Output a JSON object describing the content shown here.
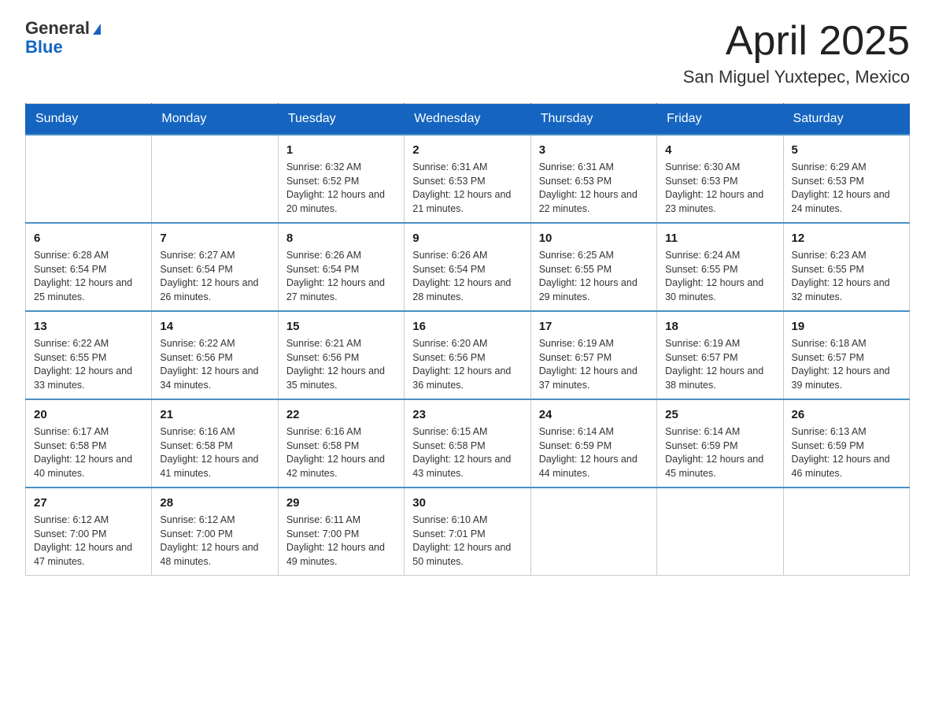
{
  "header": {
    "logo_general": "General",
    "logo_blue": "Blue",
    "month_title": "April 2025",
    "location": "San Miguel Yuxtepec, Mexico"
  },
  "weekdays": [
    "Sunday",
    "Monday",
    "Tuesday",
    "Wednesday",
    "Thursday",
    "Friday",
    "Saturday"
  ],
  "weeks": [
    [
      {
        "day": "",
        "sunrise": "",
        "sunset": "",
        "daylight": ""
      },
      {
        "day": "",
        "sunrise": "",
        "sunset": "",
        "daylight": ""
      },
      {
        "day": "1",
        "sunrise": "Sunrise: 6:32 AM",
        "sunset": "Sunset: 6:52 PM",
        "daylight": "Daylight: 12 hours and 20 minutes."
      },
      {
        "day": "2",
        "sunrise": "Sunrise: 6:31 AM",
        "sunset": "Sunset: 6:53 PM",
        "daylight": "Daylight: 12 hours and 21 minutes."
      },
      {
        "day": "3",
        "sunrise": "Sunrise: 6:31 AM",
        "sunset": "Sunset: 6:53 PM",
        "daylight": "Daylight: 12 hours and 22 minutes."
      },
      {
        "day": "4",
        "sunrise": "Sunrise: 6:30 AM",
        "sunset": "Sunset: 6:53 PM",
        "daylight": "Daylight: 12 hours and 23 minutes."
      },
      {
        "day": "5",
        "sunrise": "Sunrise: 6:29 AM",
        "sunset": "Sunset: 6:53 PM",
        "daylight": "Daylight: 12 hours and 24 minutes."
      }
    ],
    [
      {
        "day": "6",
        "sunrise": "Sunrise: 6:28 AM",
        "sunset": "Sunset: 6:54 PM",
        "daylight": "Daylight: 12 hours and 25 minutes."
      },
      {
        "day": "7",
        "sunrise": "Sunrise: 6:27 AM",
        "sunset": "Sunset: 6:54 PM",
        "daylight": "Daylight: 12 hours and 26 minutes."
      },
      {
        "day": "8",
        "sunrise": "Sunrise: 6:26 AM",
        "sunset": "Sunset: 6:54 PM",
        "daylight": "Daylight: 12 hours and 27 minutes."
      },
      {
        "day": "9",
        "sunrise": "Sunrise: 6:26 AM",
        "sunset": "Sunset: 6:54 PM",
        "daylight": "Daylight: 12 hours and 28 minutes."
      },
      {
        "day": "10",
        "sunrise": "Sunrise: 6:25 AM",
        "sunset": "Sunset: 6:55 PM",
        "daylight": "Daylight: 12 hours and 29 minutes."
      },
      {
        "day": "11",
        "sunrise": "Sunrise: 6:24 AM",
        "sunset": "Sunset: 6:55 PM",
        "daylight": "Daylight: 12 hours and 30 minutes."
      },
      {
        "day": "12",
        "sunrise": "Sunrise: 6:23 AM",
        "sunset": "Sunset: 6:55 PM",
        "daylight": "Daylight: 12 hours and 32 minutes."
      }
    ],
    [
      {
        "day": "13",
        "sunrise": "Sunrise: 6:22 AM",
        "sunset": "Sunset: 6:55 PM",
        "daylight": "Daylight: 12 hours and 33 minutes."
      },
      {
        "day": "14",
        "sunrise": "Sunrise: 6:22 AM",
        "sunset": "Sunset: 6:56 PM",
        "daylight": "Daylight: 12 hours and 34 minutes."
      },
      {
        "day": "15",
        "sunrise": "Sunrise: 6:21 AM",
        "sunset": "Sunset: 6:56 PM",
        "daylight": "Daylight: 12 hours and 35 minutes."
      },
      {
        "day": "16",
        "sunrise": "Sunrise: 6:20 AM",
        "sunset": "Sunset: 6:56 PM",
        "daylight": "Daylight: 12 hours and 36 minutes."
      },
      {
        "day": "17",
        "sunrise": "Sunrise: 6:19 AM",
        "sunset": "Sunset: 6:57 PM",
        "daylight": "Daylight: 12 hours and 37 minutes."
      },
      {
        "day": "18",
        "sunrise": "Sunrise: 6:19 AM",
        "sunset": "Sunset: 6:57 PM",
        "daylight": "Daylight: 12 hours and 38 minutes."
      },
      {
        "day": "19",
        "sunrise": "Sunrise: 6:18 AM",
        "sunset": "Sunset: 6:57 PM",
        "daylight": "Daylight: 12 hours and 39 minutes."
      }
    ],
    [
      {
        "day": "20",
        "sunrise": "Sunrise: 6:17 AM",
        "sunset": "Sunset: 6:58 PM",
        "daylight": "Daylight: 12 hours and 40 minutes."
      },
      {
        "day": "21",
        "sunrise": "Sunrise: 6:16 AM",
        "sunset": "Sunset: 6:58 PM",
        "daylight": "Daylight: 12 hours and 41 minutes."
      },
      {
        "day": "22",
        "sunrise": "Sunrise: 6:16 AM",
        "sunset": "Sunset: 6:58 PM",
        "daylight": "Daylight: 12 hours and 42 minutes."
      },
      {
        "day": "23",
        "sunrise": "Sunrise: 6:15 AM",
        "sunset": "Sunset: 6:58 PM",
        "daylight": "Daylight: 12 hours and 43 minutes."
      },
      {
        "day": "24",
        "sunrise": "Sunrise: 6:14 AM",
        "sunset": "Sunset: 6:59 PM",
        "daylight": "Daylight: 12 hours and 44 minutes."
      },
      {
        "day": "25",
        "sunrise": "Sunrise: 6:14 AM",
        "sunset": "Sunset: 6:59 PM",
        "daylight": "Daylight: 12 hours and 45 minutes."
      },
      {
        "day": "26",
        "sunrise": "Sunrise: 6:13 AM",
        "sunset": "Sunset: 6:59 PM",
        "daylight": "Daylight: 12 hours and 46 minutes."
      }
    ],
    [
      {
        "day": "27",
        "sunrise": "Sunrise: 6:12 AM",
        "sunset": "Sunset: 7:00 PM",
        "daylight": "Daylight: 12 hours and 47 minutes."
      },
      {
        "day": "28",
        "sunrise": "Sunrise: 6:12 AM",
        "sunset": "Sunset: 7:00 PM",
        "daylight": "Daylight: 12 hours and 48 minutes."
      },
      {
        "day": "29",
        "sunrise": "Sunrise: 6:11 AM",
        "sunset": "Sunset: 7:00 PM",
        "daylight": "Daylight: 12 hours and 49 minutes."
      },
      {
        "day": "30",
        "sunrise": "Sunrise: 6:10 AM",
        "sunset": "Sunset: 7:01 PM",
        "daylight": "Daylight: 12 hours and 50 minutes."
      },
      {
        "day": "",
        "sunrise": "",
        "sunset": "",
        "daylight": ""
      },
      {
        "day": "",
        "sunrise": "",
        "sunset": "",
        "daylight": ""
      },
      {
        "day": "",
        "sunrise": "",
        "sunset": "",
        "daylight": ""
      }
    ]
  ]
}
